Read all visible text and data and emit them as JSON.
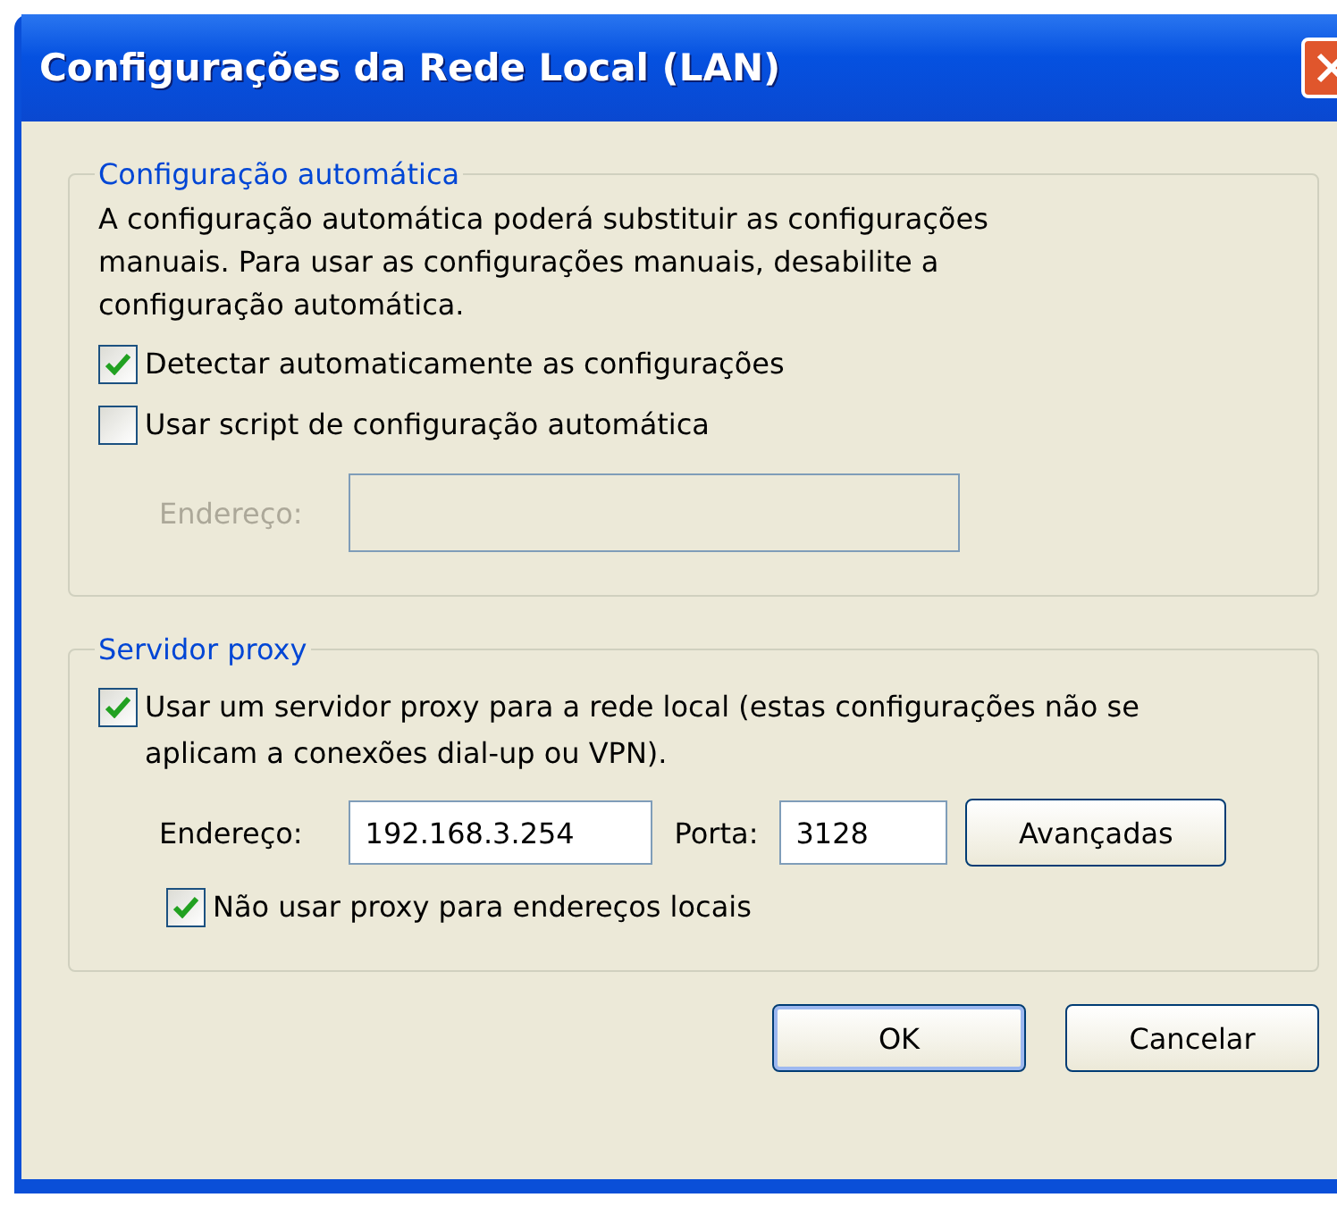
{
  "window": {
    "title": "Configurações da Rede Local (LAN)"
  },
  "auto_config": {
    "legend": "Configuração automática",
    "description": "A configuração automática poderá substituir as configurações manuais. Para usar as configurações manuais, desabilite a configuração automática.",
    "checkboxes": [
      {
        "label": "Detectar automaticamente as configurações",
        "checked": true
      },
      {
        "label": "Usar script de configuração automática",
        "checked": false
      }
    ],
    "address": {
      "label": "Endereço:",
      "disabled": true
    }
  },
  "proxy": {
    "legend": "Servidor proxy",
    "use_proxy": {
      "label": "Usar um servidor proxy para a rede local (estas configurações não se aplicam a conexões dial-up ou VPN).",
      "checked": true
    },
    "address": {
      "label": "Endereço:",
      "value": "192.168.3.254"
    },
    "port": {
      "label": "Porta:",
      "value": "3128"
    },
    "advanced_button": "Avançadas",
    "bypass_local": {
      "label": "Não usar proxy para endereços locais",
      "checked": true
    }
  },
  "buttons": [
    "OK",
    "Cancelar"
  ]
}
